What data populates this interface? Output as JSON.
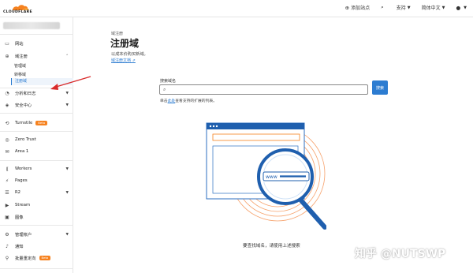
{
  "brand": {
    "name": "CLOUDFLARE",
    "accent": "#f6821f"
  },
  "topbar": {
    "add_site": "添加站点",
    "support": "支持",
    "language": "简体中文"
  },
  "sidebar": {
    "items": [
      {
        "label": "网站",
        "icon": "browser-icon"
      },
      {
        "label": "域注册",
        "icon": "globe-icon"
      },
      {
        "label": "分析和日志",
        "icon": "chart-icon"
      },
      {
        "label": "安全中心",
        "icon": "shield-icon"
      },
      {
        "label": "Turnstile",
        "icon": "turnstile-icon",
        "badge": "Beta"
      },
      {
        "label": "Zero Trust",
        "icon": "zerotrust-icon"
      },
      {
        "label": "Area 1",
        "icon": "area1-icon"
      },
      {
        "label": "Workers",
        "icon": "workers-icon"
      },
      {
        "label": "Pages",
        "icon": "pages-icon"
      },
      {
        "label": "R2",
        "icon": "r2-icon"
      },
      {
        "label": "Stream",
        "icon": "stream-icon"
      },
      {
        "label": "图像",
        "icon": "image-icon"
      },
      {
        "label": "管理帐户",
        "icon": "gear-icon"
      },
      {
        "label": "通知",
        "icon": "bell-icon"
      },
      {
        "label": "批量重定向",
        "icon": "redirect-icon",
        "badge": "Beta"
      }
    ],
    "sub_items": [
      "管理域",
      "转移域",
      "注册域"
    ]
  },
  "main": {
    "breadcrumb": "域注册",
    "title": "注册域",
    "subtitle": "以成本价购买新域。",
    "doc_link": "域注册文档",
    "search_label": "搜索域名",
    "search_value": "",
    "search_button": "搜索",
    "hint_prefix": "单击",
    "hint_link": "此处",
    "hint_suffix": "查看支持的扩展的列表。",
    "illustration_text": "www",
    "empty_message": "要查找域名，请使用上述搜索"
  },
  "watermark": "知乎 @NUTSWP"
}
